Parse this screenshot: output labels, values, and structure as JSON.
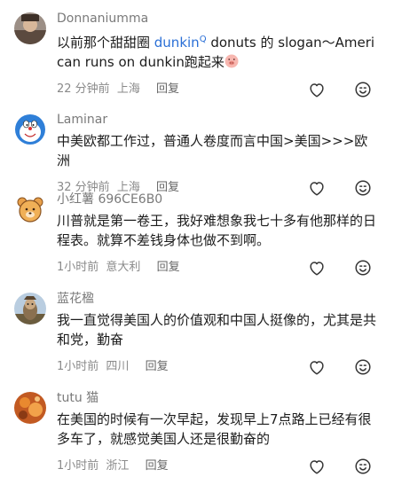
{
  "comments": [
    {
      "username": "Donnaniumma",
      "content_pre": "以前那个甜甜圈 ",
      "content_link": "dunkin",
      "content_link_icon": "Q",
      "content_post": "  donuts 的 slogan～American runs on dunkin跑起来",
      "emoji": "pig-face-emoji",
      "time": "22 分钟前",
      "location": "上海",
      "reply": "回复"
    },
    {
      "username": "Laminar",
      "content": "中美欧都工作过，普通人卷度而言中国>美国>>>欧洲",
      "time": "32 分钟前",
      "location": "上海",
      "reply": "回复"
    },
    {
      "username": "小红薯 696CE6B0",
      "content": "川普就是第一卷王，我好难想象我七十多有他那样的日程表。就算不差钱身体也做不到啊。",
      "time": "1小时前",
      "location": "意大利",
      "reply": "回复"
    },
    {
      "username": "蓝花楹",
      "content": "我一直觉得美国人的价值观和中国人挺像的，尤其是共和党，勤奋",
      "time": "1小时前",
      "location": "四川",
      "reply": "回复"
    },
    {
      "username": "tutu 猫",
      "content": "在美国的时候有一次早起，发现早上7点路上已经有很多车了，就感觉美国人还是很勤奋的",
      "time": "1小时前",
      "location": "浙江",
      "reply": "回复"
    }
  ],
  "icons": {
    "like": "heart-icon",
    "more": "emoji-face-icon"
  }
}
